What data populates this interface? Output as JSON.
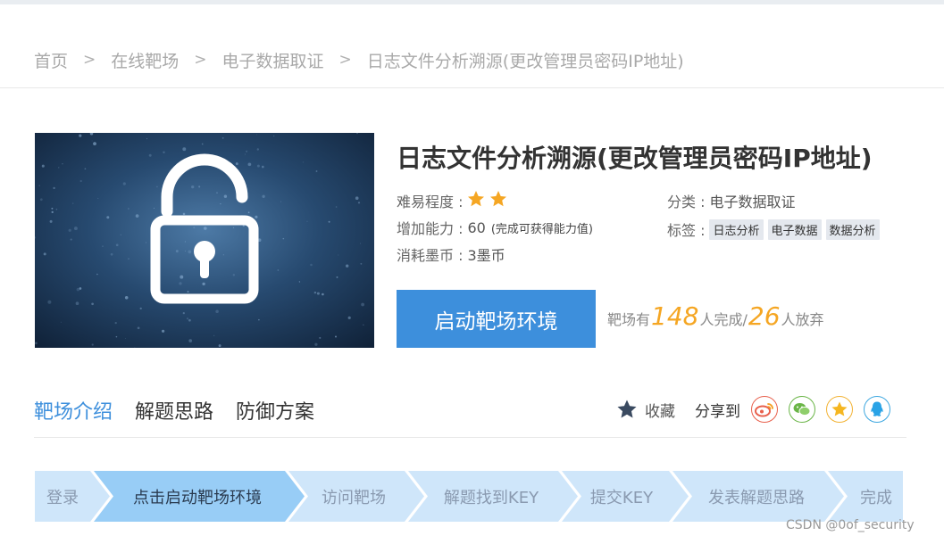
{
  "breadcrumb": {
    "items": [
      "首页",
      "在线靶场",
      "电子数据取证",
      "日志文件分析溯源(更改管理员密码IP地址)"
    ],
    "separator": ">"
  },
  "challenge": {
    "title": "日志文件分析溯源(更改管理员密码IP地址)",
    "difficulty_label": "难易程度 :",
    "difficulty_stars": 2,
    "ability_label": "增加能力 :",
    "ability_value": "60",
    "ability_note": "(完成可获得能力值)",
    "cost_label": "消耗墨币 :",
    "cost_value": "3墨币",
    "category_label": "分类 :",
    "category_value": "电子数据取证",
    "tags_label": "标签 :",
    "tags": [
      "日志分析",
      "电子数据",
      "数据分析"
    ]
  },
  "start_button": {
    "label": "启动靶场环境"
  },
  "stats": {
    "prefix": "靶场有",
    "completed": "148",
    "completed_suffix": "人完成/",
    "abandoned": "26",
    "abandoned_suffix": "人放弃"
  },
  "tabs": [
    {
      "label": "靶场介绍",
      "active": true
    },
    {
      "label": "解题思路",
      "active": false
    },
    {
      "label": "防御方案",
      "active": false
    }
  ],
  "actions": {
    "favorite_label": "收藏",
    "share_label": "分享到",
    "share_icons": [
      "weibo-icon",
      "wechat-icon",
      "qzone-icon",
      "qq-icon"
    ]
  },
  "steps": [
    {
      "label": "登录",
      "active": false
    },
    {
      "label": "点击启动靶场环境",
      "active": true
    },
    {
      "label": "访问靶场",
      "active": false
    },
    {
      "label": "解题找到KEY",
      "active": false
    },
    {
      "label": "提交KEY",
      "active": false
    },
    {
      "label": "发表解题思路",
      "active": false
    },
    {
      "label": "完成",
      "active": false
    }
  ],
  "watermark": "CSDN @0of_security",
  "colors": {
    "accent": "#3d8fdc",
    "star": "#f5a623",
    "step_inactive": "#cfe6fa",
    "step_active": "#98cdf6"
  }
}
